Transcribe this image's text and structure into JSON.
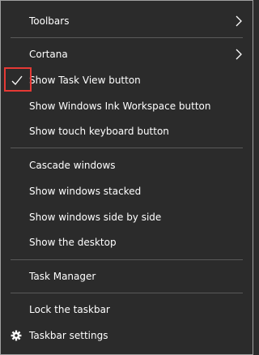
{
  "menu": {
    "items": [
      {
        "label": "Toolbars",
        "submenu": true
      },
      {
        "label": "Cortana",
        "submenu": true
      },
      {
        "label": "Show Task View button",
        "checked": true
      },
      {
        "label": "Show Windows Ink Workspace button"
      },
      {
        "label": "Show touch keyboard button"
      },
      {
        "label": "Cascade windows"
      },
      {
        "label": "Show windows stacked"
      },
      {
        "label": "Show windows side by side"
      },
      {
        "label": "Show the desktop"
      },
      {
        "label": "Task Manager"
      },
      {
        "label": "Lock the taskbar"
      },
      {
        "label": "Taskbar settings",
        "icon": "gear-icon"
      }
    ]
  },
  "colors": {
    "background": "#2b2b2b",
    "text": "#ffffff",
    "separator": "#5a5a5a",
    "highlight": "#e53935"
  }
}
